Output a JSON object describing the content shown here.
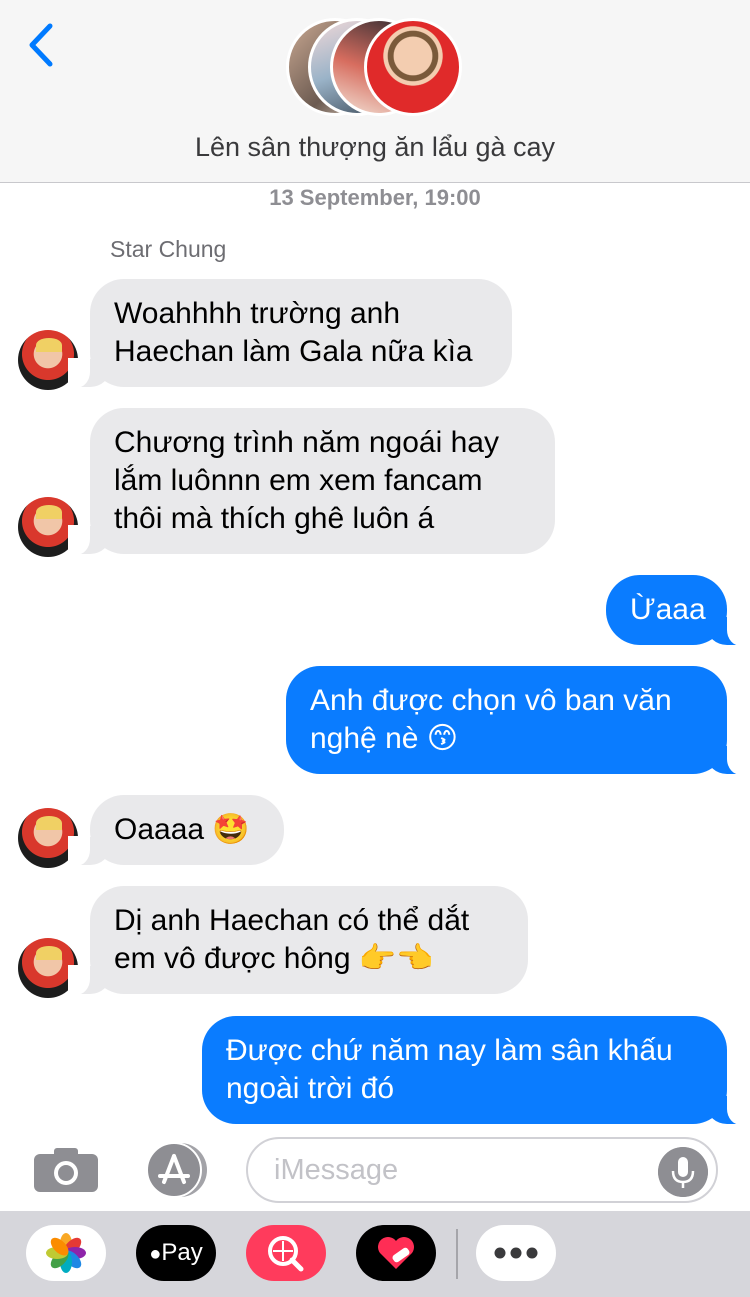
{
  "header": {
    "title": "Lên sân thượng ăn lẩu gà cay",
    "back_label": "<"
  },
  "thread": {
    "timestamp": "13 September, 19:00",
    "sender": "Star Chung",
    "messages": [
      {
        "direction": "incoming",
        "text": "Woahhhh trường anh\nHaechan làm Gala nữa kìa"
      },
      {
        "direction": "incoming",
        "text": "Chương trình năm ngoái hay\nlắm luônnn em xem fancam\nthôi mà thích ghê luôn á"
      },
      {
        "direction": "outgoing",
        "text": "Ừaaa"
      },
      {
        "direction": "outgoing",
        "text": "Anh được chọn vô ban văn\nnghệ nè 😙"
      },
      {
        "direction": "incoming",
        "text": "Oaaaa 🤩"
      },
      {
        "direction": "incoming",
        "text": "Dị anh Haechan có thể dắt\nem vô được hông 👉👈"
      },
      {
        "direction": "outgoing",
        "text": "Được chứ năm nay làm sân khấu\nngoài trời đó"
      }
    ]
  },
  "compose": {
    "placeholder": "iMessage"
  },
  "app_drawer": {
    "items": [
      {
        "name": "photos-app-icon"
      },
      {
        "name": "apple-pay-icon",
        "label": "Pay"
      },
      {
        "name": "image-search-icon"
      },
      {
        "name": "digital-touch-icon"
      },
      {
        "name": "more-apps-icon"
      }
    ]
  },
  "colors": {
    "outgoing_bubble": "#0a7cff",
    "incoming_bubble": "#e9e9eb",
    "accent": "#007aff"
  }
}
